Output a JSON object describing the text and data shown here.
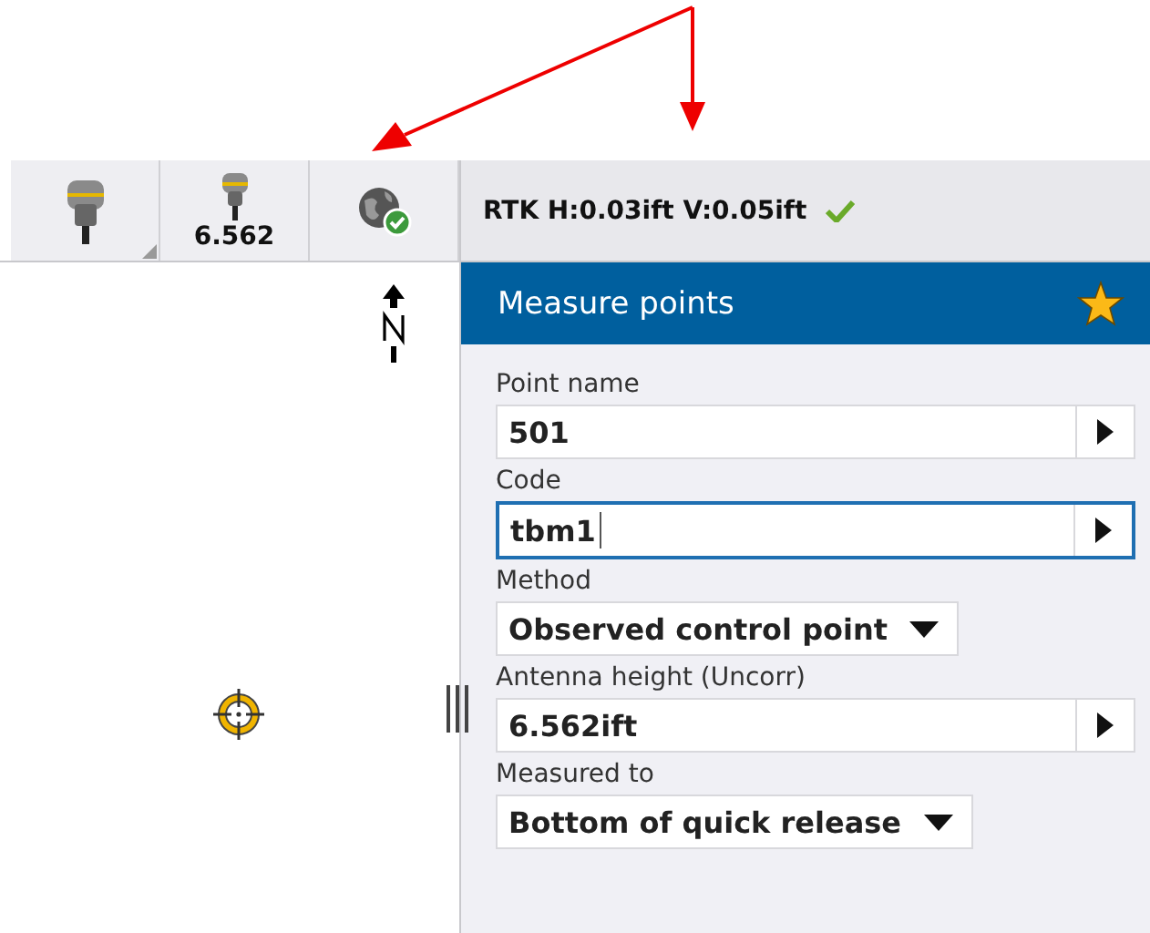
{
  "toolbar": {
    "buttons": [
      {
        "kind": "receiver"
      },
      {
        "kind": "receiver-height",
        "caption": "6.562"
      },
      {
        "kind": "internet"
      }
    ]
  },
  "status": {
    "text": "RTK H:0.03ift V:0.05ift",
    "ok": true
  },
  "panel": {
    "title": "Measure points",
    "favorite": true,
    "fields": [
      {
        "kind": "text",
        "label": "Point name",
        "value": "501",
        "focused": false
      },
      {
        "kind": "text",
        "label": "Code",
        "value": "tbm1",
        "focused": true
      },
      {
        "kind": "dropdown",
        "label": "Method",
        "value": "Observed control point"
      },
      {
        "kind": "text",
        "label": "Antenna height (Uncorr)",
        "value": "6.562ift",
        "focused": false
      },
      {
        "kind": "dropdown",
        "label": "Measured to",
        "value": "Bottom of quick release"
      }
    ]
  }
}
